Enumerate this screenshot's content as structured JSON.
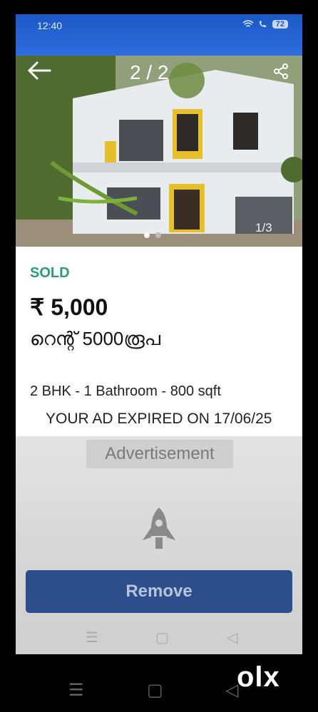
{
  "status_bar": {
    "time": "12:40",
    "icons": [
      "wifi-icon",
      "call-icon",
      "signal-icon"
    ],
    "battery": "72"
  },
  "gallery": {
    "counter": "2 / 2",
    "image_count": "1/3",
    "watermark": "OLX"
  },
  "listing": {
    "status": "SOLD",
    "price": "₹ 5,000",
    "title": "റെന്റ് 5000രൂപ",
    "details": "2 BHK - 1 Bathroom - 800 sqft",
    "expiry": "YOUR AD EXPIRED ON 17/06/25"
  },
  "ad_section": {
    "label": "Advertisement",
    "remove_label": "Remove"
  },
  "nav": {
    "menu": "☰",
    "home": "▢",
    "back": "◁"
  },
  "colors": {
    "status_bar": "#2f6fe0",
    "sold": "#2a9d6c",
    "remove_button": "#2c4f8c"
  }
}
